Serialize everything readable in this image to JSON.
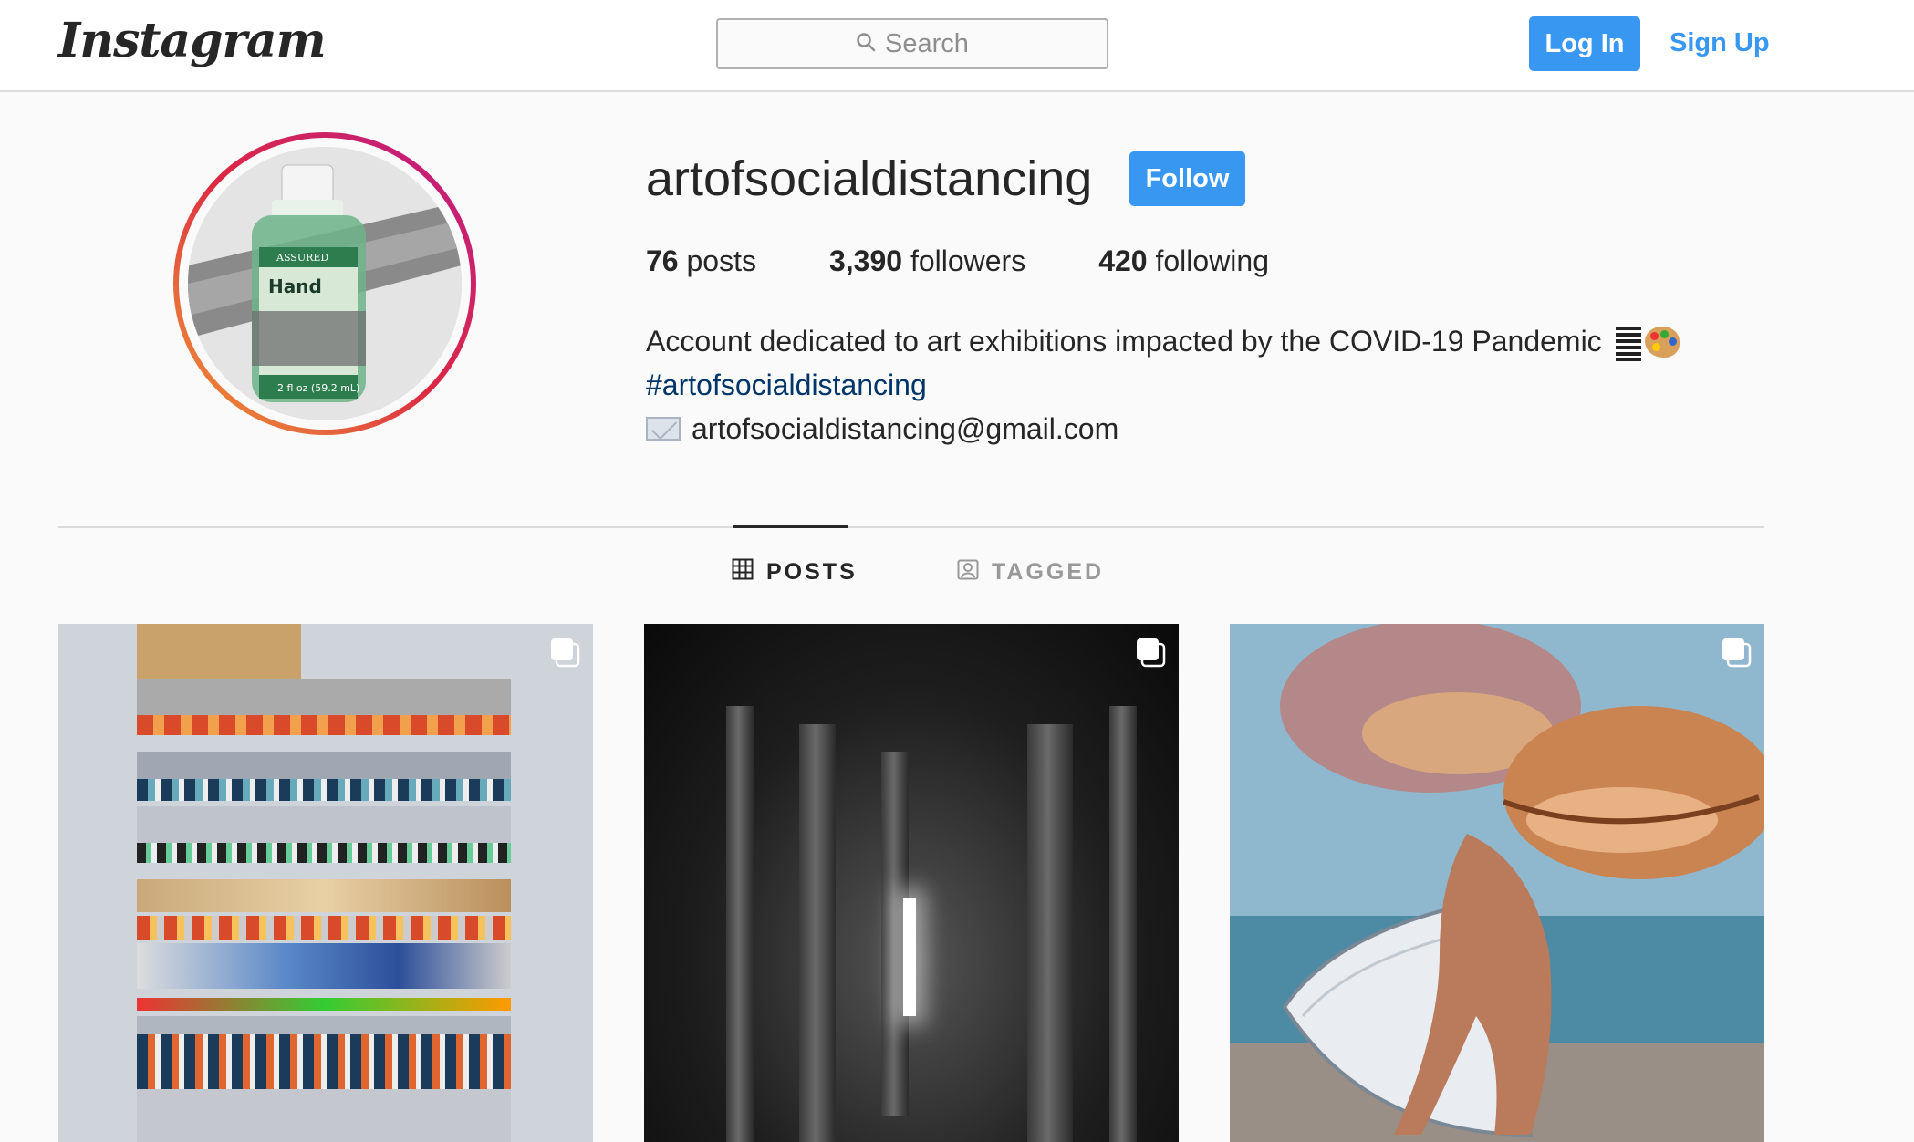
{
  "nav": {
    "logo": "Instagram",
    "search_placeholder": "Search",
    "login_label": "Log In",
    "signup_label": "Sign Up"
  },
  "profile": {
    "username": "artofsocialdistancing",
    "follow_label": "Follow",
    "stats": {
      "posts_count": "76",
      "posts_label": "posts",
      "followers_count": "3,390",
      "followers_label": "followers",
      "following_count": "420",
      "following_label": "following"
    },
    "bio": {
      "line1": "Account dedicated to art exhibitions impacted by the COVID-19 Pandemic",
      "hashtag": "#artofsocialdistancing",
      "email": "artofsocialdistancing@gmail.com"
    },
    "avatar_text": {
      "brand": "ASSURED",
      "line": "Hand",
      "volume": "2 fl oz (59.2 mL)"
    }
  },
  "tabs": [
    {
      "label": "POSTS",
      "active": true,
      "icon": "grid-icon"
    },
    {
      "label": "TAGGED",
      "active": false,
      "icon": "tagged-icon"
    }
  ],
  "colors": {
    "accent": "#3897f0",
    "hashtag": "#003569",
    "border": "#dbdbdb",
    "background": "#fafafa"
  }
}
